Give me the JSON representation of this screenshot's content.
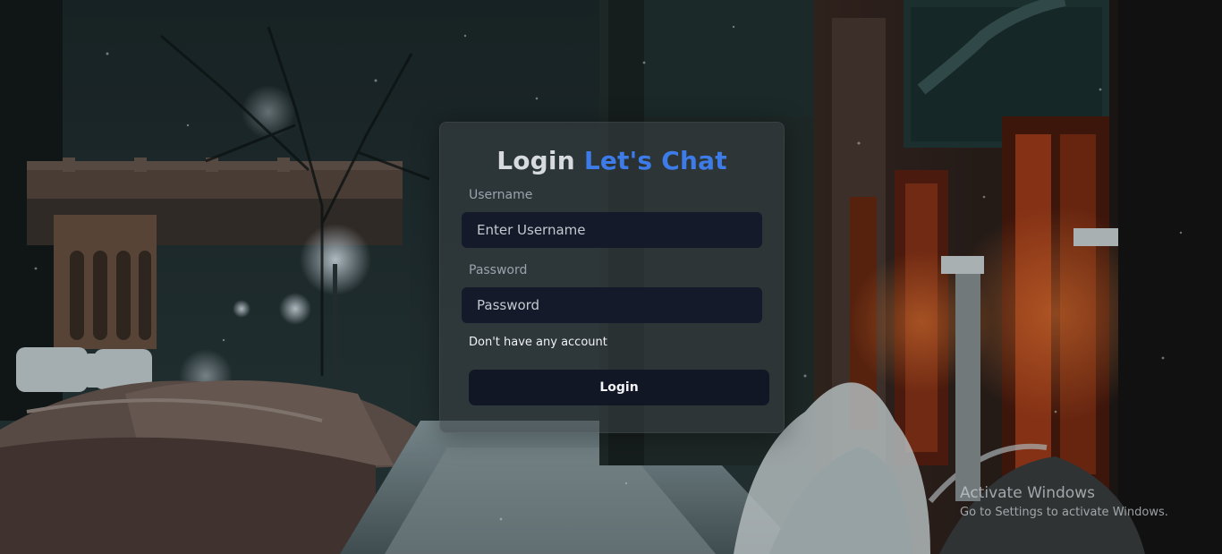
{
  "login_card": {
    "title_part1": "Login",
    "title_part2": "Let's Chat",
    "username_label": "Username",
    "username_placeholder": "Enter Username",
    "password_label": "Password",
    "password_placeholder": "Password",
    "signup_link": "Don't have any account",
    "login_button": "Login"
  },
  "watermark": {
    "title": "Activate Windows",
    "subtitle": "Go to Settings to activate Windows."
  },
  "colors": {
    "accent": "#3d7ce8",
    "input_bg": "#151a2a",
    "button_bg": "#121726",
    "card_bg": "#3a4246"
  }
}
